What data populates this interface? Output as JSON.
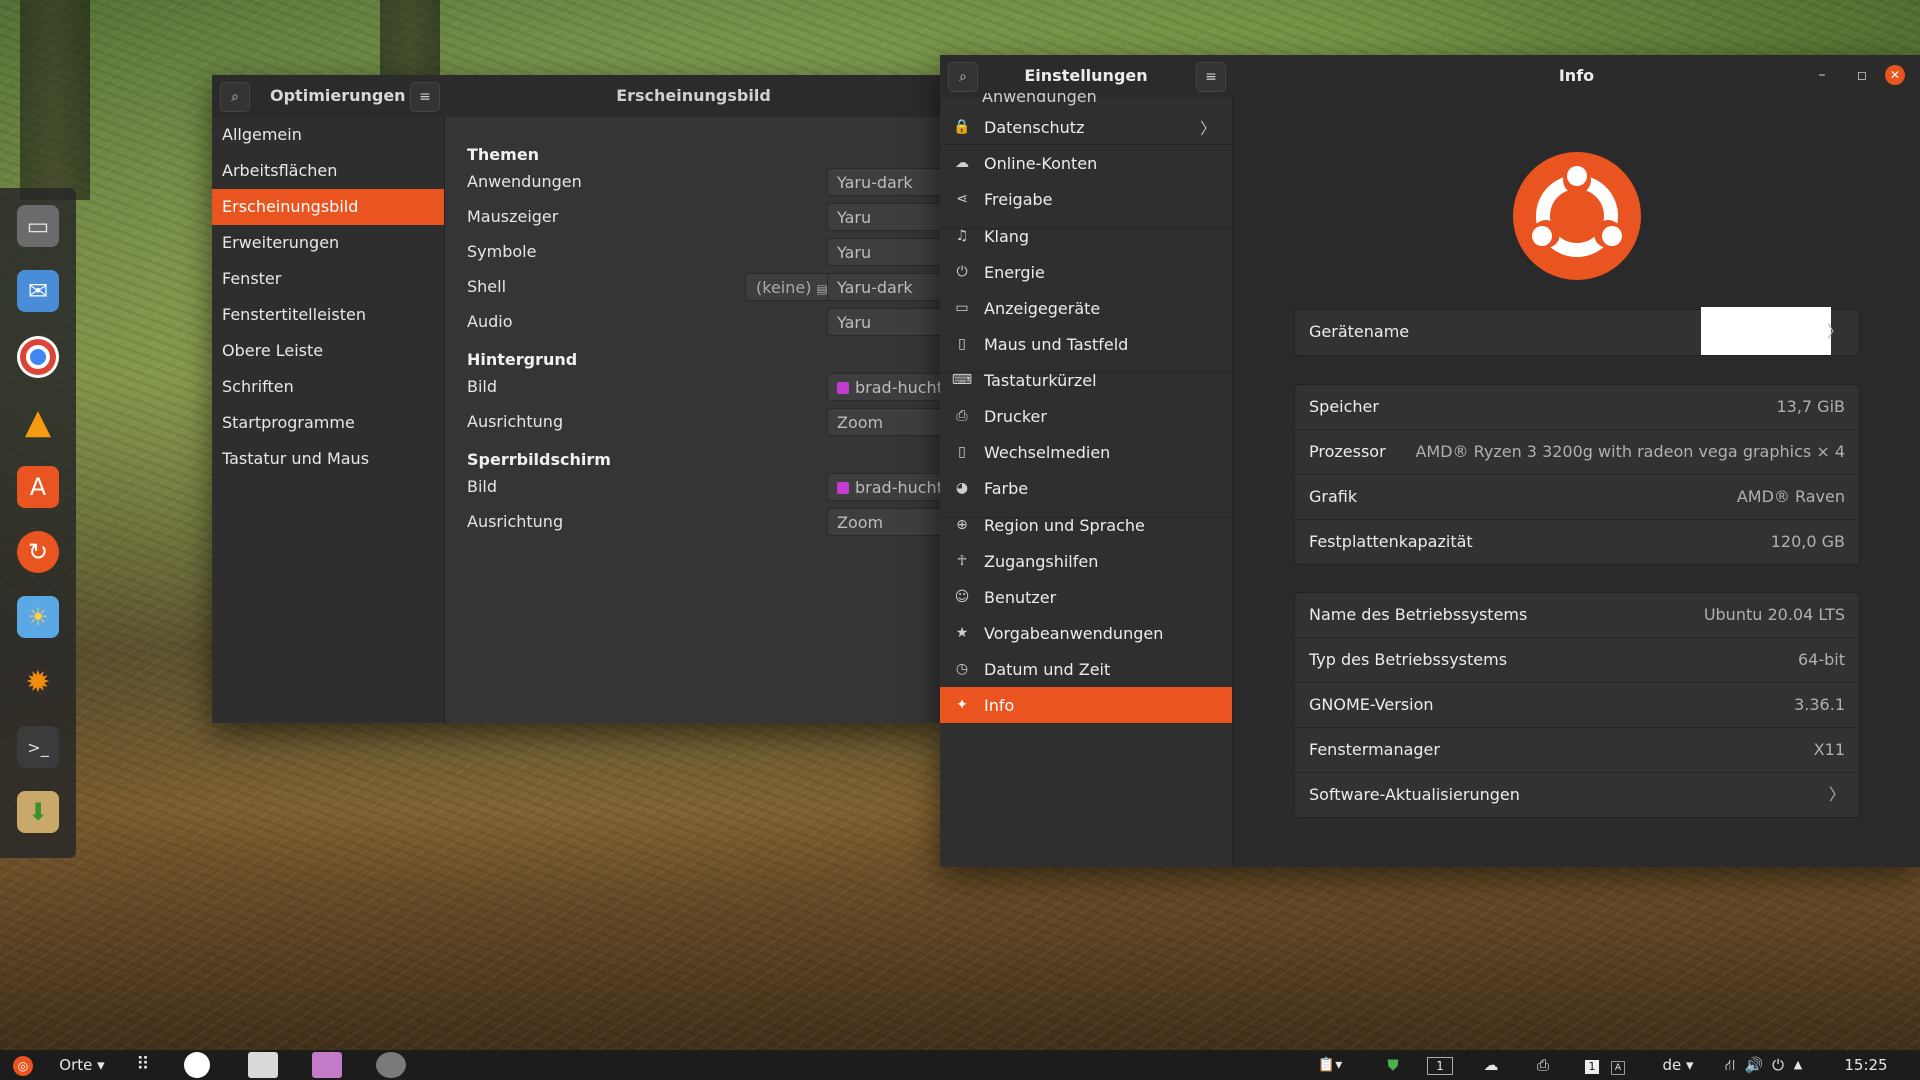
{
  "tweaks": {
    "title": "Optimierungen",
    "panel_title": "Erscheinungsbild",
    "sidebar": [
      "Allgemein",
      "Arbeitsflächen",
      "Erscheinungsbild",
      "Erweiterungen",
      "Fenster",
      "Fenstertitelleisten",
      "Obere Leiste",
      "Schriften",
      "Startprogramme",
      "Tastatur und Maus"
    ],
    "selected_index": 2,
    "sections": {
      "themen": "Themen",
      "hintergrund": "Hintergrund",
      "sperrbildschirm": "Sperrbildschirm"
    },
    "labels": {
      "anwendungen": "Anwendungen",
      "mauszeiger": "Mauszeiger",
      "symbole": "Symbole",
      "shell": "Shell",
      "audio": "Audio",
      "bild": "Bild",
      "ausrichtung": "Ausrichtung"
    },
    "values": {
      "anwendungen": "Yaru-dark",
      "mauszeiger": "Yaru",
      "symbole": "Yaru",
      "shell_none": "(keine)",
      "shell": "Yaru-dark",
      "audio": "Yaru",
      "bg_bild": "brad-huchte",
      "bg_ausrichtung": "Zoom",
      "lock_bild": "brad-huchte",
      "lock_ausrichtung": "Zoom"
    }
  },
  "settings": {
    "title": "Einstellungen",
    "panel_title": "Info",
    "sidebar_partial": "Anwendungen",
    "sidebar": [
      {
        "label": "Datenschutz",
        "icon": "lock-icon",
        "chevron": "〉"
      },
      {
        "label": "Online-Konten",
        "icon": "cloud-icon"
      },
      {
        "label": "Freigabe",
        "icon": "share-icon"
      },
      {
        "label": "Klang",
        "icon": "music-note-icon"
      },
      {
        "label": "Energie",
        "icon": "power-icon"
      },
      {
        "label": "Anzeigegeräte",
        "icon": "display-icon"
      },
      {
        "label": "Maus und Tastfeld",
        "icon": "mouse-icon"
      },
      {
        "label": "Tastaturkürzel",
        "icon": "keyboard-icon"
      },
      {
        "label": "Drucker",
        "icon": "printer-icon"
      },
      {
        "label": "Wechselmedien",
        "icon": "removable-media-icon"
      },
      {
        "label": "Farbe",
        "icon": "color-icon"
      },
      {
        "label": "Region und Sprache",
        "icon": "globe-icon"
      },
      {
        "label": "Zugangshilfen",
        "icon": "accessibility-icon"
      },
      {
        "label": "Benutzer",
        "icon": "user-icon"
      },
      {
        "label": "Vorgabeanwendungen",
        "icon": "star-icon"
      },
      {
        "label": "Datum und Zeit",
        "icon": "clock-icon"
      },
      {
        "label": "Info",
        "icon": "sparkle-icon"
      }
    ],
    "device_name_label": "Gerätename",
    "device_chevron": "〉",
    "hardware": [
      {
        "key": "Speicher",
        "value": "13,7 GiB"
      },
      {
        "key": "Prozessor",
        "value": "AMD® Ryzen 3 3200g with radeon vega graphics × 4"
      },
      {
        "key": "Grafik",
        "value": "AMD® Raven"
      },
      {
        "key": "Festplattenkapazität",
        "value": "120,0 GB"
      }
    ],
    "os": [
      {
        "key": "Name des Betriebssystems",
        "value": "Ubuntu 20.04 LTS"
      },
      {
        "key": "Typ des Betriebssystems",
        "value": "64-bit"
      },
      {
        "key": "GNOME-Version",
        "value": "3.36.1"
      },
      {
        "key": "Fenstermanager",
        "value": "X11"
      },
      {
        "key": "Software-Aktualisierungen",
        "value": "〉"
      }
    ],
    "accent": "#e95420"
  },
  "taskbar": {
    "places": "Orte ▾",
    "workspace": "1",
    "keyboard_badge": "1",
    "language": "de ▾",
    "clock": "15:25"
  },
  "dock_apps": [
    "files-icon",
    "mail-icon",
    "chrome-icon",
    "vlc-icon",
    "software-center-icon",
    "update-icon",
    "weather-icon",
    "xsane-icon",
    "terminal-icon",
    "archive-icon"
  ]
}
